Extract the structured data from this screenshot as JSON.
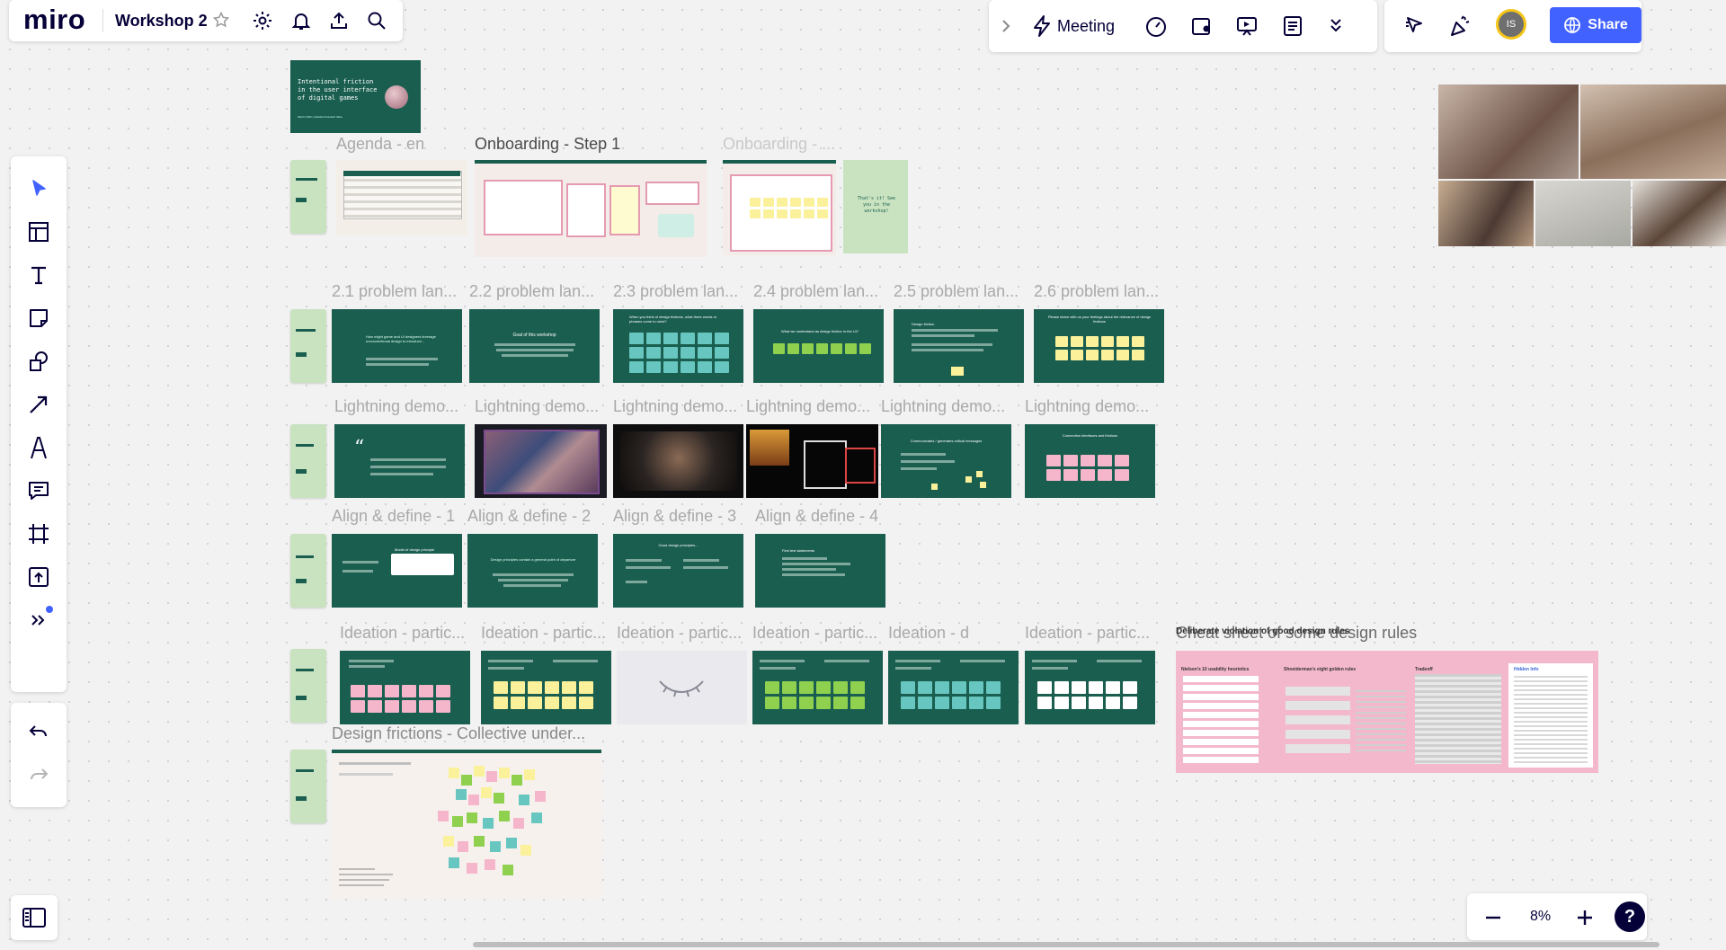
{
  "app": {
    "logo": "miro",
    "board_title": "Workshop 2"
  },
  "topbar": {
    "meeting_label": "Meeting",
    "share_label": "Share",
    "avatar_initials": "IS"
  },
  "cover": {
    "title": "Intentional friction in the user interface of digital games",
    "subtitle": "March 2022 | Isabelle Kniestedt Ulloa"
  },
  "sections": {
    "row1": [
      "Agenda - en",
      "Onboarding - Step 1",
      "Onboarding - ..."
    ],
    "row2": [
      "2.1 problem lan...",
      "2.2 problem lan...",
      "2.3 problem lan...",
      "2.4 problem lan...",
      "2.5 problem lan...",
      "2.6 problem lan..."
    ],
    "row3": [
      "Lightning demo...",
      "Lightning demo...",
      "Lightning demo...",
      "Lightning demo...",
      "Lightning demo...",
      "Lightning demo..."
    ],
    "row4": [
      "Align & define - 1",
      "Align & define - 2",
      "Align & define - 3",
      "Align & define - 4"
    ],
    "row5": [
      "Ideation - partic...",
      "Ideation - partic...",
      "Ideation - partic...",
      "Ideation - partic...",
      "Ideation - d",
      "Ideation - partic..."
    ],
    "row6": [
      "Design frictions - Collective under..."
    ],
    "cheat": "Cheat sheet of some design rules",
    "cheat_overlap": "Deliberate violation of good design rules"
  },
  "slides": {
    "thats_it": "That's it! See you in the workshop!",
    "r2s1_a": "How might game and UI designers leverage unconventional design to introduce...",
    "r2s2_a": "Goal of this workshop",
    "r2s3_a": "When you think of design frictions, what three words or phrases come to mind?",
    "r2s4_a": "What we understand as design friction in the UI?",
    "r2s5_a": "Design friction",
    "r2s6_a": "Please share with us your feelings about the relevance of design frictions",
    "r3s5_a": "Communicates / generates critical messages",
    "r3s6_a": "Connection interfaces and frictions",
    "r4s1_a": "Model of design principle",
    "r4s2_a": "Design principles contain a general point of departure",
    "r4s3_a": "Good design principles...",
    "r4s4_a": "First test statements",
    "cheat_left": "Nielsen's 10 usability heuristics",
    "cheat_mid": "Shneiderman's eight golden rules",
    "cheat_right": "Tradeoff",
    "cheat_far": "Hidden Info"
  },
  "zoom": {
    "level": "8%"
  },
  "colors": {
    "accent": "#4262ff",
    "frame_green": "#1a5e4f",
    "sticky_pink": "#f5b5cb",
    "sticky_yellow": "#fbf19b",
    "sticky_green": "#8fd14f",
    "sticky_teal": "#67c6c0"
  }
}
